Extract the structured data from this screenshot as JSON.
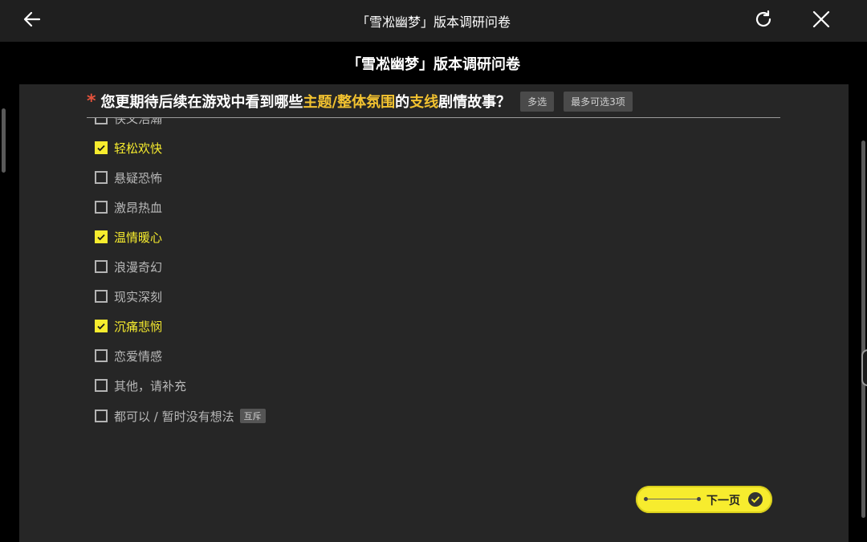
{
  "topbar": {
    "title": "「雪凇幽梦」版本调研问卷",
    "back_icon": "arrow-left-icon",
    "refresh_icon": "refresh-icon",
    "close_icon": "close-icon"
  },
  "header": {
    "title": "「雪凇幽梦」版本调研问卷"
  },
  "question": {
    "required_mark": "*",
    "text_parts": [
      "您更期待后续在游戏中看到哪些",
      "主题/整体氛围",
      "的",
      "支线",
      "剧情故事？"
    ],
    "tags": [
      "多选",
      "最多可选3项"
    ]
  },
  "options": [
    {
      "label": "侠义浩瀚",
      "checked": false
    },
    {
      "label": "轻松欢快",
      "checked": true
    },
    {
      "label": "悬疑恐怖",
      "checked": false
    },
    {
      "label": "激昂热血",
      "checked": false
    },
    {
      "label": "温情暖心",
      "checked": true
    },
    {
      "label": "浪漫奇幻",
      "checked": false
    },
    {
      "label": "现实深刻",
      "checked": false
    },
    {
      "label": "沉痛悲悯",
      "checked": true
    },
    {
      "label": "恋爱情感",
      "checked": false
    },
    {
      "label": "其他，请补充",
      "checked": false
    },
    {
      "label": "都可以 / 暂时没有想法",
      "checked": false,
      "tag": "互斥"
    }
  ],
  "next_button": {
    "label": "下一页",
    "icon": "check-circle-icon"
  },
  "colors": {
    "accent_yellow": "#f7ec2e",
    "highlight_orange": "#f2c230",
    "required_red": "#e6533c",
    "panel_bg": "#262626"
  }
}
